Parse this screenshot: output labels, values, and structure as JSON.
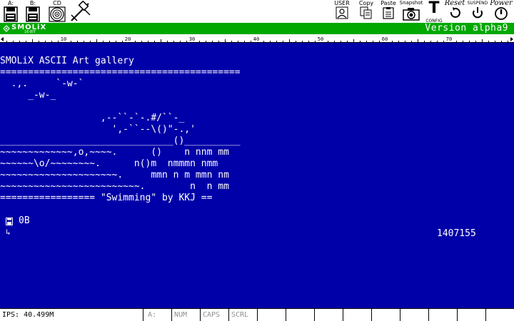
{
  "toolbar": {
    "drive_a_label": "A:",
    "drive_b_label": "B:",
    "drive_cd_label": "CD",
    "user_label": "USER",
    "copy_label": "Copy",
    "paste_label": "Paste",
    "snapshot_label": "Snapshot",
    "config_label": "CONFIG",
    "config_glyph": "T",
    "reset_label": "Reset",
    "suspend_label": "SUSPEND",
    "power_label": "Power"
  },
  "brand": {
    "logo_text": "SMOLiX",
    "logo_sub": "16-BIT",
    "version": "Version alpha9"
  },
  "ruler": {
    "marks": [
      "10",
      "20",
      "30",
      "40",
      "50",
      "60",
      "70"
    ]
  },
  "screen": {
    "lines": [
      "SMOLiX ASCII Art gallery",
      "===========================================",
      "  .,.     `-w-`",
      "     _-w-_",
      "",
      "                  ,--``-`-.#/``-_",
      "                    ',-``--\\()\"-.,'",
      "_______________________________()__________",
      "~~~~~~~~~~~~~,o,~~~~.      ()    n nnm mm",
      "~~~~~~\\o/~~~~~~~~.      n()m  nmmmn nmm",
      "~~~~~~~~~~~~~~~~~~~~~.     mmn n m mmn nm",
      "~~~~~~~~~~~~~~~~~~~~~~~~~.        n  n mm",
      "================= \"Swimming\" by KKJ =="
    ],
    "drive_label": "0B",
    "prompt_arrow": "↳",
    "counter": "1407155"
  },
  "status": {
    "ips": "IPS: 40.499M",
    "drive": "A:",
    "num": "NUM",
    "caps": "CAPS",
    "scrl": "SCRL"
  },
  "colors": {
    "terminal_bg": "#0000a8",
    "brand_bar": "#00a800",
    "text": "#ffffff"
  }
}
